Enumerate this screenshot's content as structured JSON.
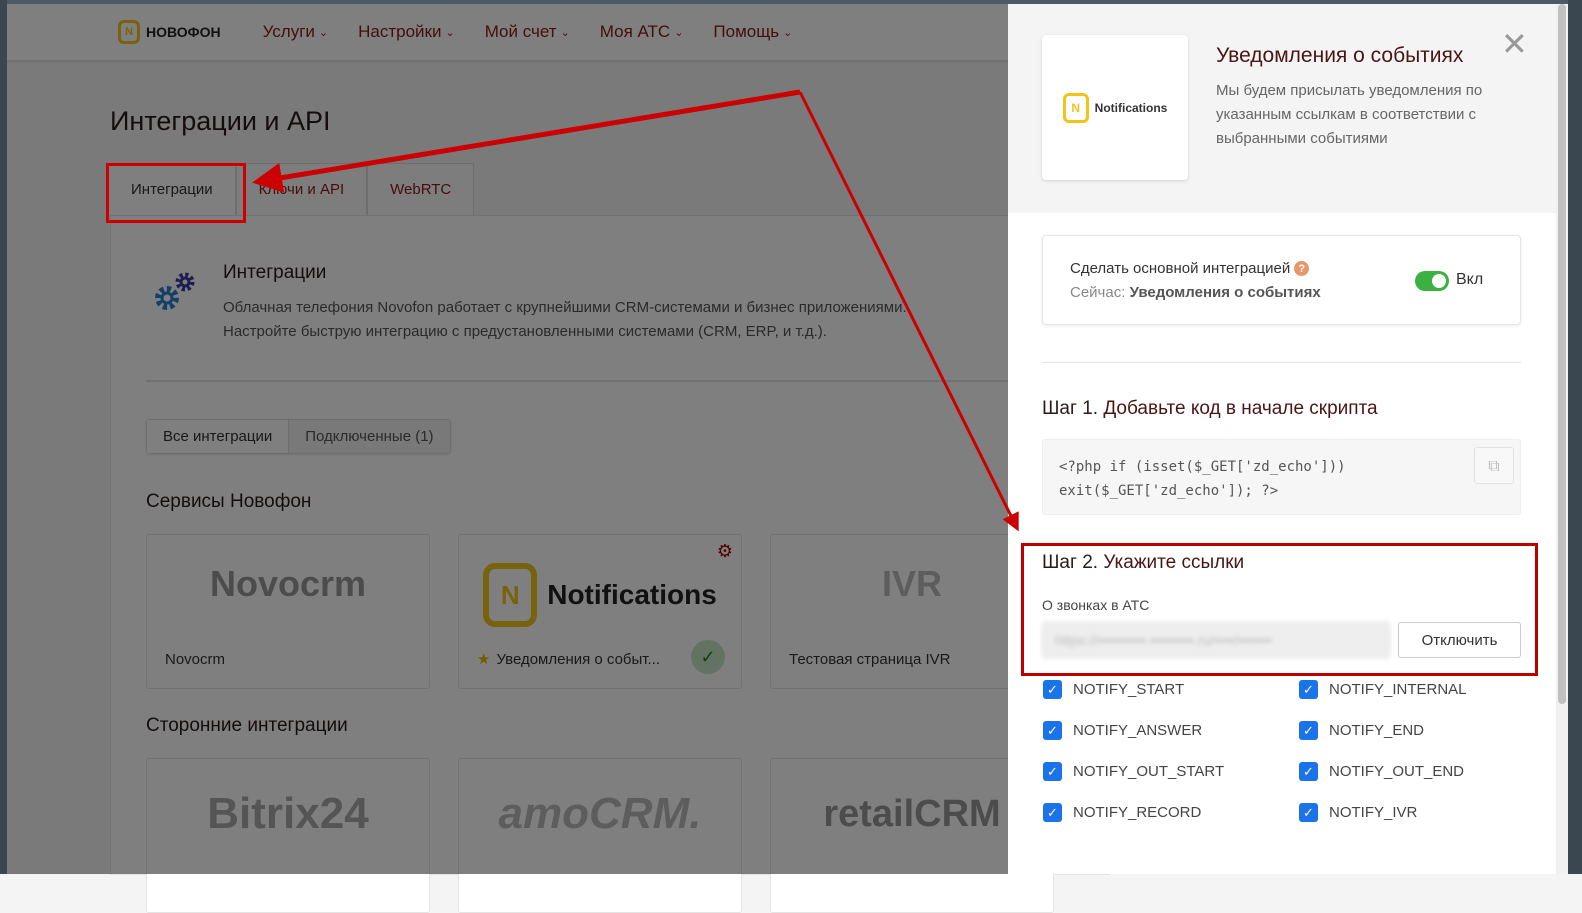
{
  "nav": {
    "logo": "НОВОФОН",
    "items": [
      "Услуги",
      "Настройки",
      "Мой счет",
      "Моя АТС",
      "Помощь"
    ]
  },
  "page": {
    "title": "Интеграции и API",
    "tabs": [
      "Интеграции",
      "Ключи и API",
      "WebRTC"
    ],
    "section_title": "Интеграции",
    "section_desc_1": "Облачная телефония Novofon работает с крупнейшими CRM-системами и бизнес приложениями.",
    "section_desc_2": "Настройте быструю интеграцию с предустановленными системами (CRM, ERP, и т.д.).",
    "filters": [
      "Все интеграции",
      "Подключенные (1)"
    ],
    "group1": "Сервисы Новофон",
    "services": [
      {
        "logo": "Novocrm",
        "name": "Novocrm"
      },
      {
        "logo": "Notifications",
        "name": "Уведомления о событ..."
      },
      {
        "logo": "IVR",
        "name": "Тестовая страница IVR"
      }
    ],
    "group2": "Сторонние интеграции",
    "third_party": [
      "Bitrix24",
      "amoCRM.",
      "retailCRM"
    ]
  },
  "panel": {
    "logo_text": "Notifications",
    "title": "Уведомления о событиях",
    "desc": "Мы будем присылать уведомления по указанным ссылкам в соответствии с выбранными событиями",
    "main_label": "Сделать основной интеграцией",
    "current_prefix": "Сейчас:",
    "current_value": "Уведомления о событиях",
    "toggle_label": "Вкл",
    "step1_prefix": "Шаг 1.",
    "step1_text": "Добавьте код в начале скрипта",
    "code_1": "<?php if (isset($_GET['zd_echo']))",
    "code_2": "exit($_GET['zd_echo']); ?>",
    "step2_prefix": "Шаг 2.",
    "step2_text": "Укажите ссылки",
    "calls_label": "О звонках в АТС",
    "url_value": "https://••••••••••.•••••••••.ru/••••/•••••••",
    "disable_button": "Отключить",
    "events": [
      "NOTIFY_START",
      "NOTIFY_INTERNAL",
      "NOTIFY_ANSWER",
      "NOTIFY_END",
      "NOTIFY_OUT_START",
      "NOTIFY_OUT_END",
      "NOTIFY_RECORD",
      "NOTIFY_IVR"
    ]
  },
  "colors": {
    "accent": "#8b1a1a",
    "annotation": "#cc0000",
    "check": "#1a73e8",
    "toggle": "#3cb043"
  }
}
